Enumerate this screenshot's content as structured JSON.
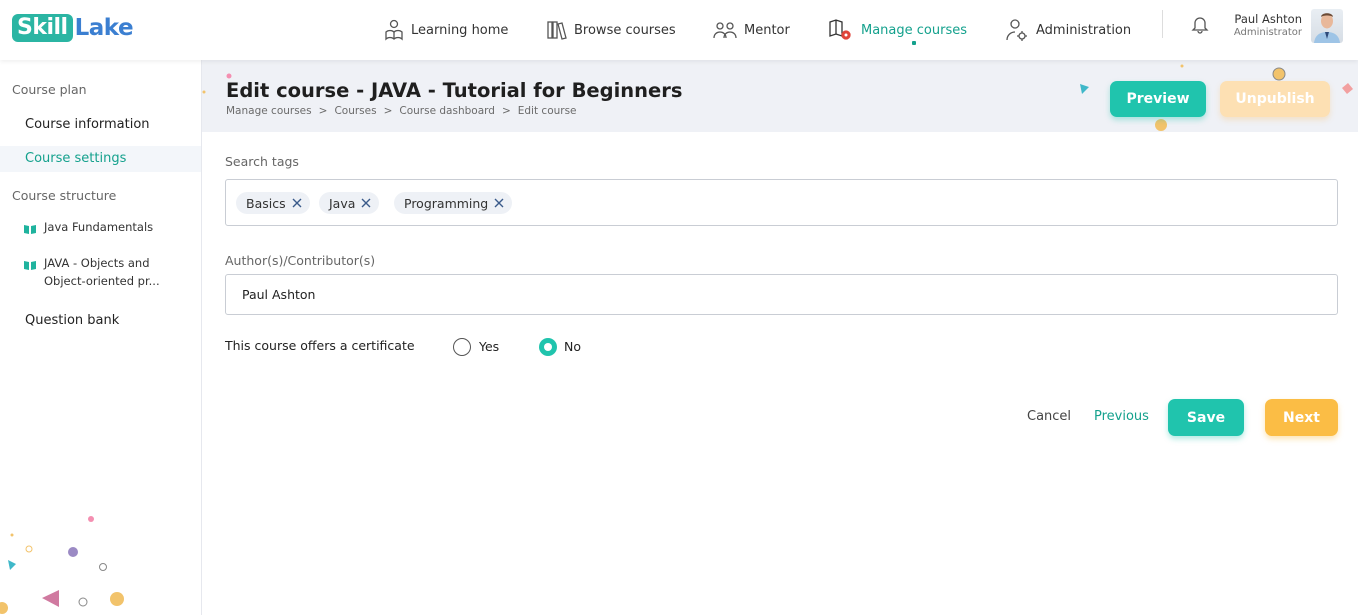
{
  "brand": {
    "part1": "Skill",
    "part2": "Lake"
  },
  "nav": {
    "learning_home": "Learning home",
    "browse_courses": "Browse courses",
    "mentor": "Mentor",
    "manage_courses": "Manage courses",
    "administration": "Administration"
  },
  "user": {
    "name": "Paul Ashton",
    "role": "Administrator"
  },
  "sidebar": {
    "course_plan": "Course plan",
    "course_information": "Course information",
    "course_settings": "Course settings",
    "course_structure": "Course structure",
    "modules": [
      {
        "title_line1": "Java Fundamentals",
        "title_line2": ""
      },
      {
        "title_line1": "JAVA - Objects and",
        "title_line2": "Object-oriented pr..."
      }
    ],
    "question_bank": "Question bank"
  },
  "page": {
    "title": "Edit course - JAVA - Tutorial for Beginners",
    "breadcrumb": [
      "Manage courses",
      "Courses",
      "Course dashboard",
      "Edit course"
    ],
    "preview": "Preview",
    "unpublish": "Unpublish"
  },
  "form": {
    "search_tags_label": "Search tags",
    "tags": [
      "Basics",
      "Java",
      "Programming"
    ],
    "authors_label": "Author(s)/Contributor(s)",
    "authors_value": "Paul Ashton",
    "certificate_label": "This course offers a certificate",
    "option_yes": "Yes",
    "option_no": "No",
    "certificate_selected": "No"
  },
  "actions": {
    "cancel": "Cancel",
    "previous": "Previous",
    "save": "Save",
    "next": "Next"
  },
  "colors": {
    "accent": "#20c4ad",
    "accent_text": "#14a18d",
    "next": "#fbbd45",
    "unpublish": "#fde0b3"
  },
  "icons": [
    "learning-home-icon",
    "browse-courses-icon",
    "mentor-icon",
    "manage-courses-icon",
    "administration-icon",
    "bell-icon",
    "book-icon",
    "close-icon"
  ]
}
